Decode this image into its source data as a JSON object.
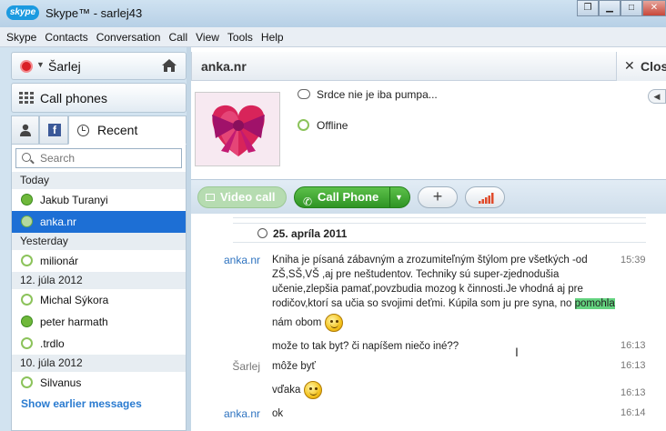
{
  "window": {
    "title": "Skype™ - sarlej43",
    "logo": "skype"
  },
  "menu": [
    "Skype",
    "Contacts",
    "Conversation",
    "Call",
    "View",
    "Tools",
    "Help"
  ],
  "user": {
    "name": "Šarlej",
    "status_color": "#d91f26"
  },
  "call_phones": {
    "label": "Call phones"
  },
  "tabs": {
    "recent": "Recent"
  },
  "search": {
    "placeholder": "Search"
  },
  "contacts": {
    "today_header": "Today",
    "yesterday_header": "Yesterday",
    "date1_header": "12. júla 2012",
    "date2_header": "10. júla 2012",
    "items": [
      {
        "name": "Jakub Turanyi",
        "status": "online"
      },
      {
        "name": "anka.nr",
        "status": "phone"
      },
      {
        "name": "milionár",
        "status": "offline"
      },
      {
        "name": "Michal Sýkora",
        "status": "offline"
      },
      {
        "name": "peter harmath",
        "status": "online"
      },
      {
        "name": ".trdlo",
        "status": "offline"
      },
      {
        "name": "Silvanus",
        "status": "offline"
      }
    ],
    "show_earlier": "Show earlier messages"
  },
  "conversation": {
    "name": "anka.nr",
    "close_label": "Clos",
    "mood": "Srdce nie je iba pumpa...",
    "status": "Offline"
  },
  "toolbar": {
    "video_call": "Video call",
    "call_phone": "Call Phone",
    "add": "+"
  },
  "chat": {
    "date": "25. apríla 2011",
    "messages": [
      {
        "sender": "anka.nr",
        "time": "15:39",
        "line1": "Kniha je písaná zábavným a zrozumiteľným štýlom pre všetkých -od",
        "line2": "ZŠ,SŠ,VŠ ,aj pre neštudentov. Techniky sú super-zjednodušia",
        "line3": "učenie,zlepšia pamať,povzbudia mozog k činnosti.Je vhodná aj pre",
        "line4": "rodičov,ktorí sa učia so svojimi deťmi. Kúpila som ju pre syna, no",
        "highlight": "pomohla",
        "line5": "nám obom"
      },
      {
        "sender": "",
        "time": "16:13",
        "text": "može to tak byt? či napíšem niečo iné??"
      },
      {
        "sender": "Šarlej",
        "time": "16:13",
        "text": "môže byť"
      },
      {
        "sender": "",
        "time": "16:13",
        "text": "vďaka"
      },
      {
        "sender": "anka.nr",
        "time": "16:14",
        "text": "ok"
      }
    ]
  }
}
